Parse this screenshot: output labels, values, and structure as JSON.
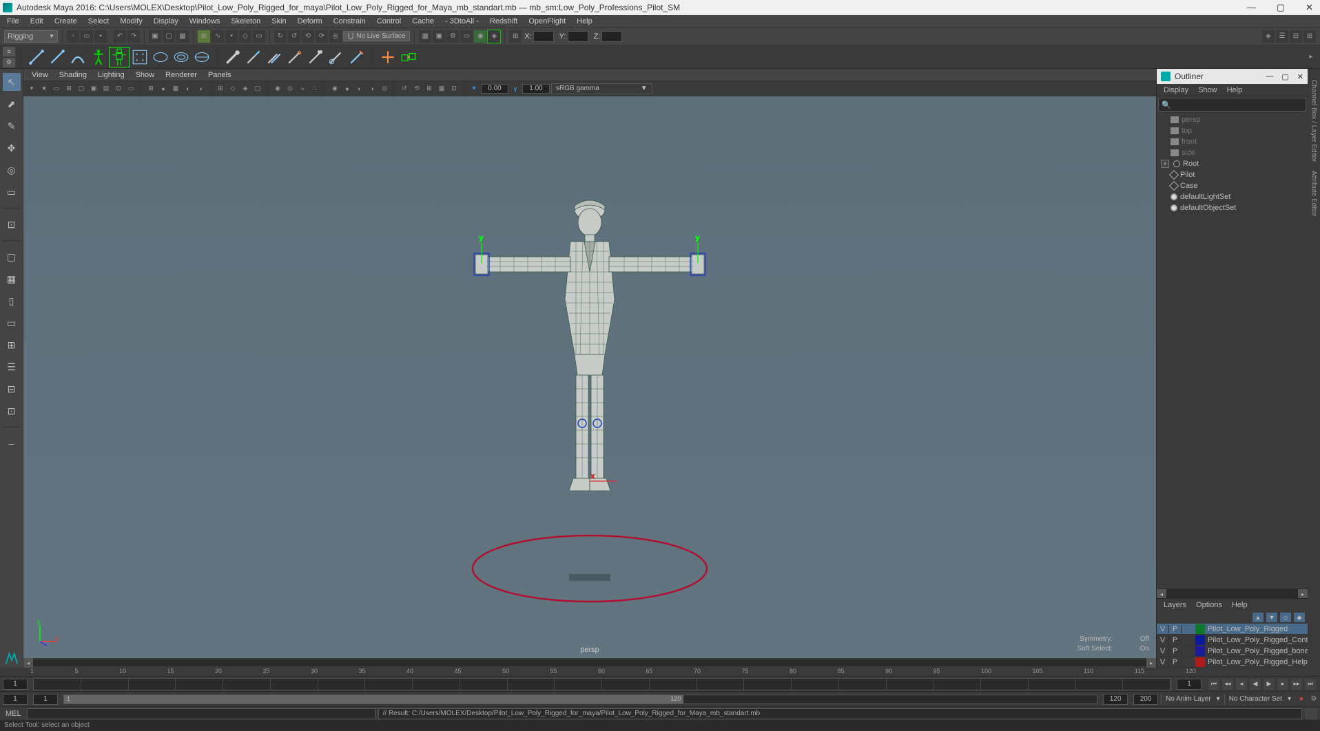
{
  "title": "Autodesk Maya 2016: C:\\Users\\MOLEX\\Desktop\\Pilot_Low_Poly_Rigged_for_maya\\Pilot_Low_Poly_Rigged_for_Maya_mb_standart.mb   ---   mb_sm:Low_Poly_Professions_Pilot_SM",
  "mainmenu": [
    "File",
    "Edit",
    "Create",
    "Select",
    "Modify",
    "Display",
    "Windows",
    "Skeleton",
    "Skin",
    "Deform",
    "Constrain",
    "Control",
    "Cache",
    "- 3DtoAll -",
    "Redshift",
    "OpenFlight",
    "Help"
  ],
  "workspace": "Rigging",
  "snap_label": "No Live Surface",
  "coords": {
    "x": "X:",
    "y": "Y:",
    "z": "Z:"
  },
  "panel_menu": [
    "View",
    "Shading",
    "Lighting",
    "Show",
    "Renderer",
    "Panels"
  ],
  "exposure": "0.00",
  "gamma_val": "1.00",
  "gamma_mode": "sRGB gamma",
  "viewport": {
    "camera": "persp",
    "symmetry_label": "Symmetry:",
    "symmetry_val": "Off",
    "soft_label": "Soft Select:",
    "soft_val": "On",
    "axis_y": "y",
    "axis_x": "x",
    "manip_y": "y",
    "manip_x": "x"
  },
  "outliner": {
    "title": "Outliner",
    "menu": [
      "Display",
      "Show",
      "Help"
    ],
    "items": [
      {
        "name": "persp",
        "type": "cam",
        "dim": true
      },
      {
        "name": "top",
        "type": "cam",
        "dim": true
      },
      {
        "name": "front",
        "type": "cam",
        "dim": true
      },
      {
        "name": "side",
        "type": "cam",
        "dim": true
      },
      {
        "name": "Root",
        "type": "joint",
        "expand": true
      },
      {
        "name": "Pilot",
        "type": "mesh"
      },
      {
        "name": "Case",
        "type": "mesh"
      },
      {
        "name": "defaultLightSet",
        "type": "set"
      },
      {
        "name": "defaultObjectSet",
        "type": "set"
      }
    ]
  },
  "layers": {
    "menu": [
      "Layers",
      "Options",
      "Help"
    ],
    "rows": [
      {
        "v": "V",
        "p": "P",
        "color": "#0a7a2a",
        "name": "Pilot_Low_Poly_Rigged",
        "sel": true
      },
      {
        "v": "V",
        "p": "P",
        "color": "#0a1a9a",
        "name": "Pilot_Low_Poly_Rigged_Controllers"
      },
      {
        "v": "V",
        "p": "P",
        "color": "#1a1a9a",
        "name": "Pilot_Low_Poly_Rigged_bones"
      },
      {
        "v": "V",
        "p": "P",
        "color": "#b01a1a",
        "name": "Pilot_Low_Poly_Rigged_Helpers"
      }
    ]
  },
  "time": {
    "cur_frame": "1",
    "start": "1",
    "end": "120",
    "range_start": "1",
    "range_end": "120",
    "anim_start": "120",
    "anim_end": "200",
    "anim_layer": "No Anim Layer",
    "char_set": "No Character Set",
    "ticks": [
      "1",
      "5",
      "10",
      "15",
      "20",
      "25",
      "30",
      "35",
      "40",
      "45",
      "50",
      "55",
      "60",
      "65",
      "70",
      "75",
      "80",
      "85",
      "90",
      "95",
      "100",
      "105",
      "110",
      "115",
      "120"
    ]
  },
  "cmd": {
    "label": "MEL",
    "result": "// Result: C:/Users/MOLEX/Desktop/Pilot_Low_Poly_Rigged_for_maya/Pilot_Low_Poly_Rigged_for_Maya_mb_standart.mb"
  },
  "help_line": "Select Tool: select an object",
  "side_tabs": [
    "Channel Box / Layer Editor",
    "Attribute Editor"
  ],
  "win": {
    "min": "—",
    "max": "▢",
    "close": "✕"
  }
}
